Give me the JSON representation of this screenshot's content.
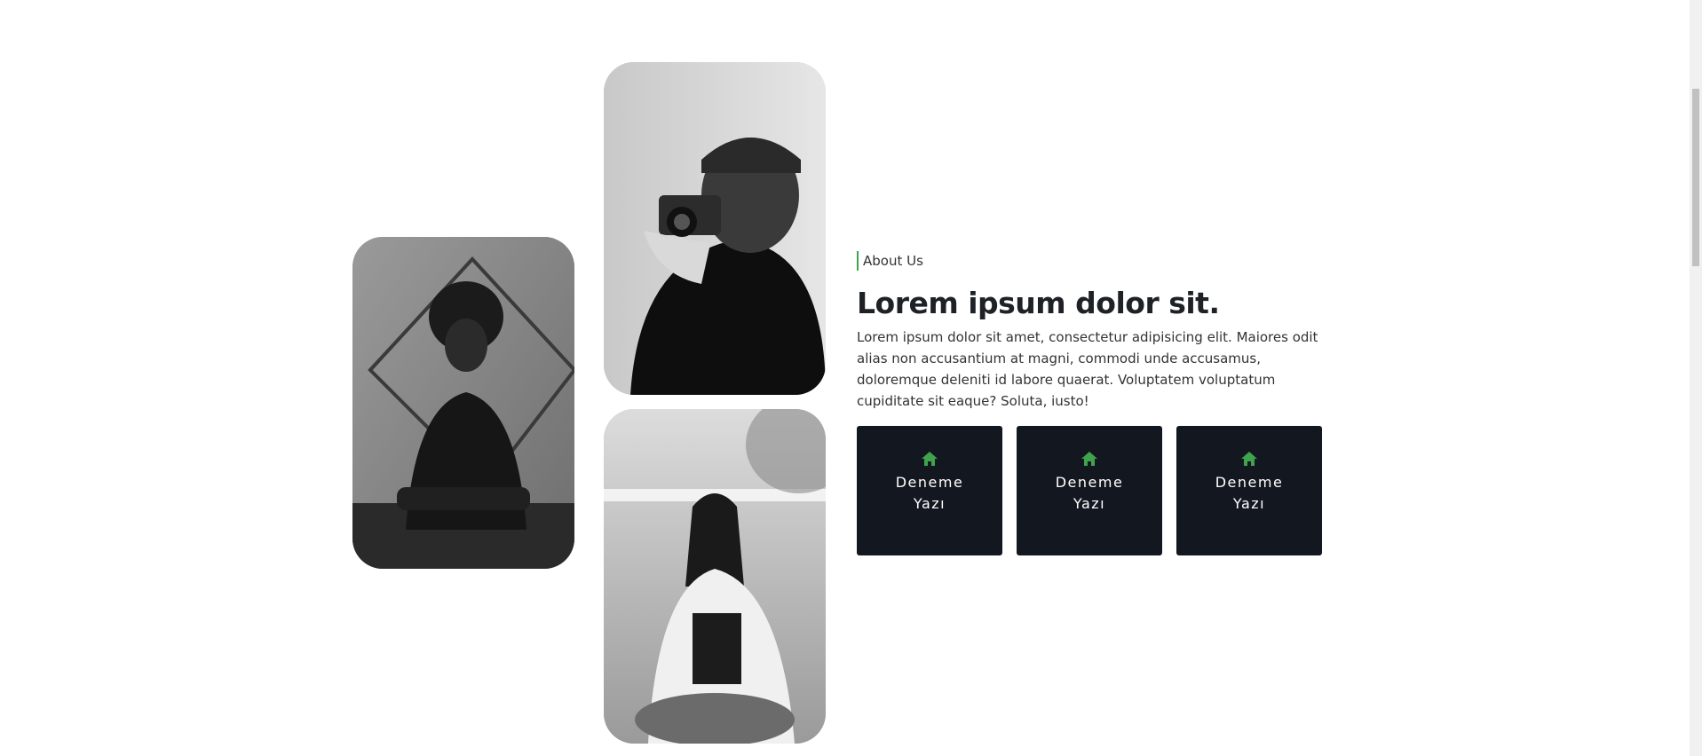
{
  "photos": [
    {
      "name": "woman-with-mirror-frame"
    },
    {
      "name": "man-with-camera"
    },
    {
      "name": "woman-sitting-outdoors"
    }
  ],
  "about": {
    "eyebrow": "About Us",
    "title": "Lorem ipsum dolor sit.",
    "body": "Lorem ipsum dolor sit amet, consectetur adipisicing elit. Maiores odit alias non accusantium at magni, commodi unde accusamus, doloremque deleniti id labore quaerat. Voluptatem voluptatum cupiditate sit eaque? Soluta, iusto!"
  },
  "cards": [
    {
      "icon": "home-icon",
      "label": "Deneme Yazı"
    },
    {
      "icon": "home-icon",
      "label": "Deneme Yazı"
    },
    {
      "icon": "home-icon",
      "label": "Deneme Yazı"
    }
  ],
  "colors": {
    "accent": "#3fa34d",
    "card_bg": "#131720",
    "text": "#212529"
  }
}
